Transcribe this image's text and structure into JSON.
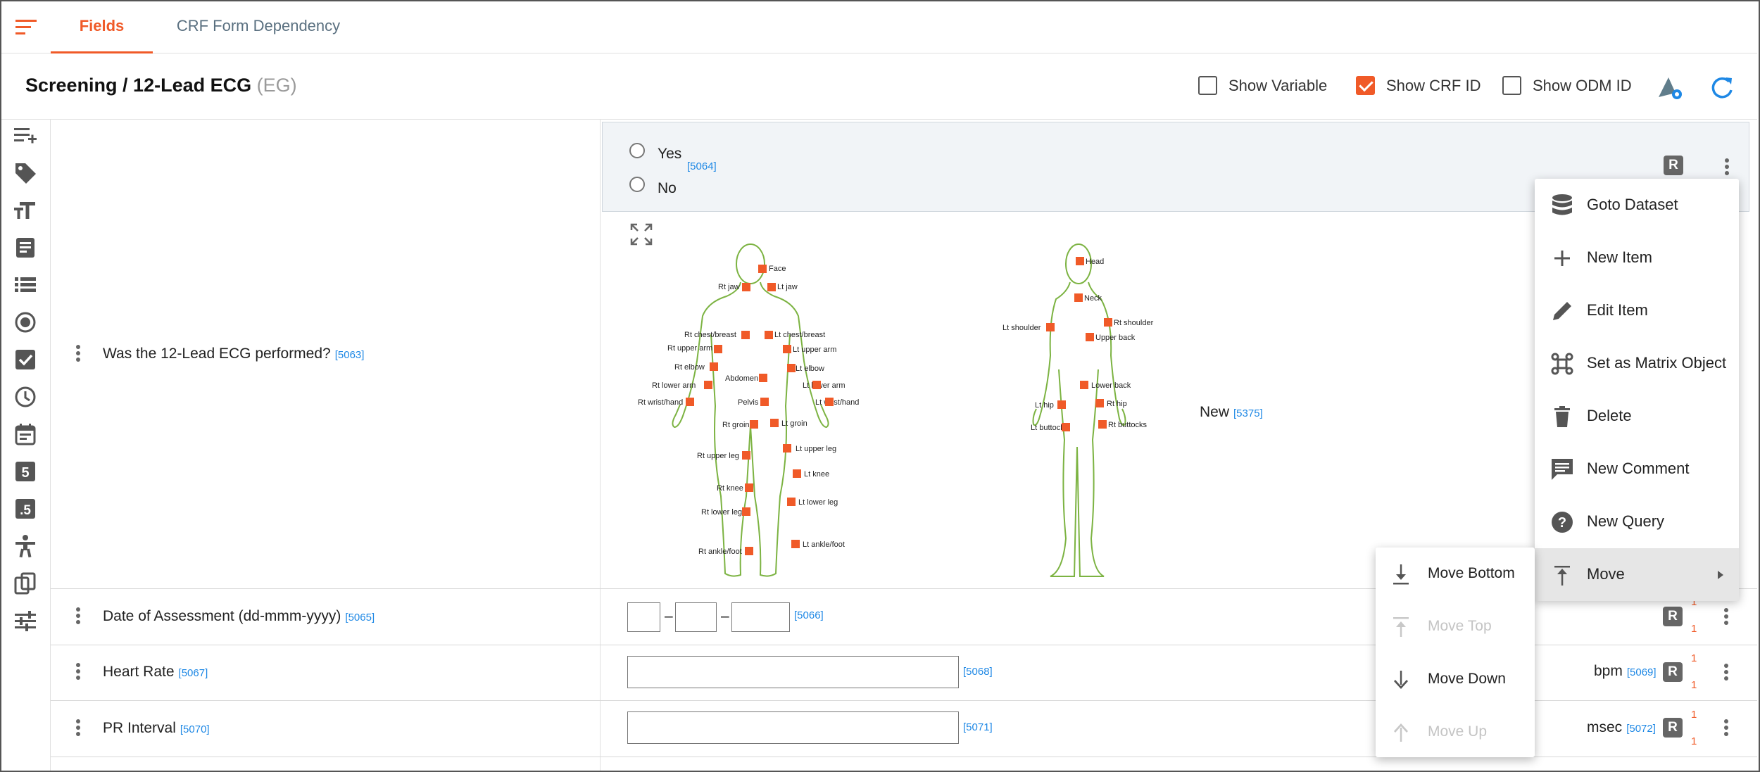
{
  "tabs": [
    {
      "label": "Fields",
      "active": true
    },
    {
      "label": "CRF Form Dependency",
      "active": false
    }
  ],
  "header": {
    "title": "Screening / 12-Lead ECG",
    "code": "(EG)",
    "show_variable": {
      "label": "Show Variable",
      "checked": false
    },
    "show_crf_id": {
      "label": "Show CRF ID",
      "checked": true
    },
    "show_odm_id": {
      "label": "Show ODM ID",
      "checked": false
    }
  },
  "toolbar_icons": [
    "add-list-icon",
    "tag-icon",
    "text-size-icon",
    "form-icon",
    "list-icon",
    "radio-icon",
    "checkbox-icon",
    "clock-icon",
    "calendar-icon",
    "number-5-icon",
    "decimal-icon",
    "body-figure-icon",
    "copy-icon",
    "settings-sliders-icon"
  ],
  "rows": {
    "ecg": {
      "question": "Was the 12-Lead ECG performed?",
      "qid": "[5063]",
      "options": [
        "Yes",
        "No"
      ],
      "option_id": "[5064]",
      "badge": "R",
      "body_new_label": "New",
      "body_new_id": "[5375]"
    },
    "date": {
      "question": "Date of Assessment (dd-mmm-yyyy)",
      "qid": "[5065]",
      "sep1": "–",
      "sep2": "–",
      "field_id": "[5066]",
      "badge": "R",
      "count1": "1",
      "count2": "1"
    },
    "hr": {
      "question": "Heart Rate",
      "qid": "[5067]",
      "field_id": "[5068]",
      "unit": "bpm",
      "unit_id": "[5069]",
      "badge": "R",
      "count1": "1",
      "count2": "1"
    },
    "pr": {
      "question": "PR Interval",
      "qid": "[5070]",
      "field_id": "[5071]",
      "unit": "msec",
      "unit_id": "[5072]",
      "badge": "R",
      "count1": "1",
      "count2": "1"
    }
  },
  "body_front_labels": [
    "Face",
    "Rt jaw",
    "Lt jaw",
    "Rt chest/breast",
    "Lt chest/breast",
    "Rt upper arm",
    "Lt upper arm",
    "Rt elbow",
    "Lt elbow",
    "Abdomen",
    "Rt lower arm",
    "Lt lower arm",
    "Rt wrist/hand",
    "Pelvis",
    "Lt wrist/hand",
    "Rt groin",
    "Lt groin",
    "Rt upper leg",
    "Lt upper leg",
    "Lt knee",
    "Rt knee",
    "Lt lower leg",
    "Rt lower leg",
    "Lt ankle/foot",
    "Rt ankle/foot"
  ],
  "body_back_labels": [
    "Head",
    "Neck",
    "Rt shoulder",
    "Lt shoulder",
    "Upper back",
    "Lower back",
    "Lt hip",
    "Rt hip",
    "Lt buttocks",
    "Rt buttocks"
  ],
  "context_menu": [
    {
      "label": "Goto Dataset",
      "icon": "database-icon"
    },
    {
      "label": "New Item",
      "icon": "plus-icon"
    },
    {
      "label": "Edit Item",
      "icon": "pencil-icon"
    },
    {
      "label": "Set as Matrix Object",
      "icon": "command-icon"
    },
    {
      "label": "Delete",
      "icon": "trash-icon"
    },
    {
      "label": "New Comment",
      "icon": "comment-icon"
    },
    {
      "label": "New Query",
      "icon": "help-circle-icon"
    },
    {
      "label": "Move",
      "icon": "move-top-icon",
      "has_submenu": true
    }
  ],
  "move_submenu": [
    {
      "label": "Move Bottom",
      "enabled": true
    },
    {
      "label": "Move Top",
      "enabled": false
    },
    {
      "label": "Move Down",
      "enabled": true
    },
    {
      "label": "Move Up",
      "enabled": false
    }
  ],
  "colors": {
    "accent": "#f05a28",
    "link": "#1e88e5",
    "body_outline": "#7cb342"
  }
}
